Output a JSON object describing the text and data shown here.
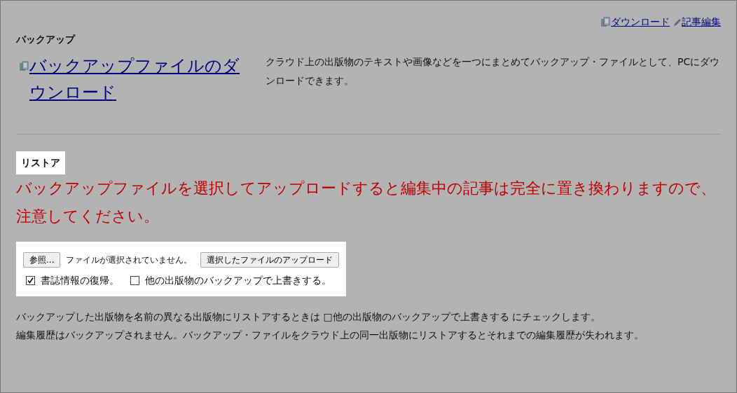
{
  "top_links": [
    {
      "kind": "download",
      "label": "ダウンロード"
    },
    {
      "kind": "edit",
      "label": "記事編集"
    }
  ],
  "backup": {
    "heading": "バックアップ",
    "link": "バックアップファイルのダウンロード",
    "description": "クラウド上の出版物のテキストや画像などを一つにまとめてバックアップ・ファイルとして、PCにダウンロードできます。"
  },
  "restore": {
    "heading": "リストア",
    "warning": "バックアップファイルを選択してアップロードすると編集中の記事は完全に置き換わりますので、注意してください。",
    "browse_button": "参照...",
    "file_status": "ファイルが選択されていません。",
    "upload_button": "選択したファイルのアップロード",
    "options": [
      {
        "label": "書誌情報の復帰。",
        "checked": true
      },
      {
        "label": "他の出版物のバックアップで上書きする。",
        "checked": false
      }
    ],
    "notes": [
      "バックアップした出版物を名前の異なる出版物にリストアするときは □他の出版物のバックアップで上書きする にチェックします。",
      "編集履歴はバックアップされません。バックアップ・ファイルをクラウド上の同一出版物にリストアするとそれまでの編集履歴が失われます。"
    ]
  }
}
